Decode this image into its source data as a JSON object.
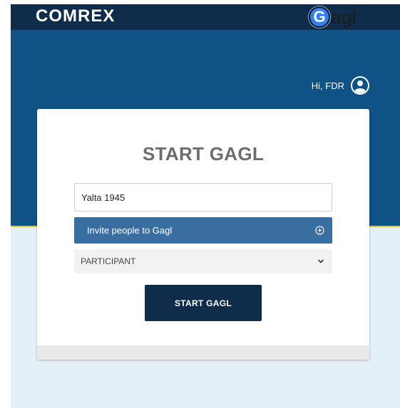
{
  "header": {
    "brand_logo_text": "COMREX",
    "app_logo_letter": "G",
    "app_logo_rest": "agl"
  },
  "user": {
    "greeting": "Hi, FDR",
    "icon": "user-circle-icon"
  },
  "form": {
    "title": "START GAGL",
    "session_name_value": "Yalta 1945",
    "invite_label": "Invite people to Gagl",
    "invite_icon": "plus-circle-icon",
    "role_selected": "PARTICIPANT",
    "role_icon": "chevron-down-icon",
    "submit_label": "START GAGL"
  },
  "colors": {
    "topbar": "#0f2c4a",
    "hero": "#0e5286",
    "accent_line": "#e8c23a",
    "page_bg": "#e4f0f7",
    "invite_button": "#3a6ea0",
    "primary_button": "#0f2c4a",
    "title_text": "#6d6d6d"
  }
}
